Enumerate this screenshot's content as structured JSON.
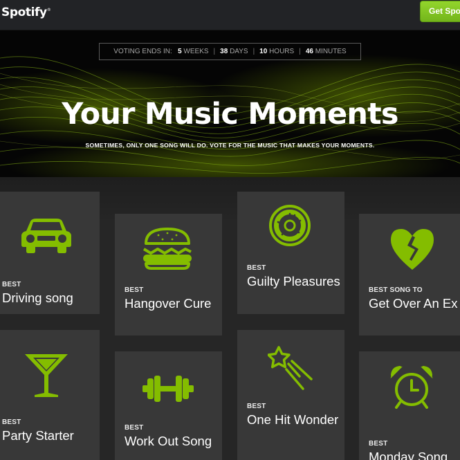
{
  "header": {
    "logo_text": "Spotify",
    "logo_mark": "®",
    "cta_label": "Get Spotify"
  },
  "countdown": {
    "prefix": "VOTING ENDS IN:",
    "weeks_value": "5",
    "weeks_unit": "WEEKS",
    "days_value": "38",
    "days_unit": "DAYS",
    "hours_value": "10",
    "hours_unit": "HOURS",
    "minutes_value": "46",
    "minutes_unit": "MINUTES"
  },
  "hero": {
    "title": "Your Music Moments",
    "subtitle": "SOMETIMES, ONLY ONE SONG WILL DO. VOTE FOR THE MUSIC THAT MAKES YOUR MOMENTS."
  },
  "categories": [
    {
      "kicker": "BEST",
      "name": "Driving song",
      "icon": "car-icon"
    },
    {
      "kicker": "BEST",
      "name": "Hangover Cure",
      "icon": "burger-icon"
    },
    {
      "kicker": "BEST",
      "name": "Guilty Pleasures",
      "icon": "donut-icon"
    },
    {
      "kicker": "BEST SONG TO",
      "name": "Get Over An Ex",
      "icon": "broken-heart-icon"
    },
    {
      "kicker": "BEST",
      "name": "Party Starter",
      "icon": "cocktail-icon"
    },
    {
      "kicker": "BEST",
      "name": "Work Out Song",
      "icon": "dumbbell-icon"
    },
    {
      "kicker": "BEST",
      "name": "One Hit Wonder",
      "icon": "shooting-star-icon"
    },
    {
      "kicker": "BEST",
      "name": "Monday Song",
      "icon": "alarm-clock-icon"
    }
  ],
  "colors": {
    "accent_green": "#84bd00",
    "tile_background": "#383838",
    "page_background": "#262626",
    "header_background": "#222326"
  }
}
